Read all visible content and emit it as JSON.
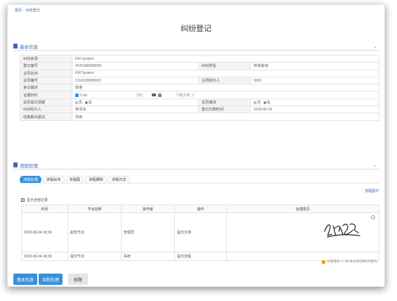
{
  "breadcrumb": {
    "home": "首页",
    "current": "纠纷登记"
  },
  "page_title": "纠纷登记",
  "basic_section": {
    "title": "基本信息"
  },
  "info_rows": [
    {
      "l1": "纠纷来源",
      "v1": "KM System"
    },
    {
      "l1": "登记编号",
      "v1": "JF20180608000",
      "l2": "纠纷类型",
      "v2": "数量差错"
    },
    {
      "l1": "合同名称",
      "v1": "KM System"
    },
    {
      "l1": "合同编号",
      "v1": "CG2018080002",
      "l2": "合同经办人",
      "v2": "0001"
    },
    {
      "l1": "争议描述",
      "v1": "数量"
    },
    {
      "l1": "证据材料",
      "file": "1.txt",
      "size": "(3B)",
      "status": "下载次数: 0"
    },
    {
      "l1": "是否提交调解",
      "r1_no": "否",
      "r1_yes": "是",
      "l2": "是否撤诉",
      "r2_no": "否",
      "r2_yes": "是"
    },
    {
      "l1": "纠纷经办人",
      "v1": "黄泽添",
      "l2": "登记日期时间",
      "v2": "2018-06-06"
    },
    {
      "l1": "结案解决建议",
      "v1": "协商"
    }
  ],
  "process_section": {
    "title": "流程处理"
  },
  "tabs": [
    "流程处理",
    "流程状态",
    "流程图",
    "流程跟踪",
    "流程日志"
  ],
  "flow_link": "流程图示",
  "toggle_label": "显示全部记录",
  "history": {
    "headers": [
      "时间",
      "节点名称",
      "操作者",
      "操作",
      "处理意见"
    ],
    "rows": [
      {
        "time": "2018-06-04 18:36",
        "node": "起草节点",
        "user": "管理员",
        "action": "提交文档"
      },
      {
        "time": "2018-06-04 18:36",
        "node": "提交节点",
        "user": "系统",
        "action": "提交流程"
      }
    ]
  },
  "footnote": "@管理员: 1, 共1条记录(请移步操作)",
  "bottom_buttons": [
    "基本信息",
    "流程处理",
    "权限"
  ],
  "colors": {
    "accent": "#3a8fd8",
    "link": "#3a67b7"
  }
}
